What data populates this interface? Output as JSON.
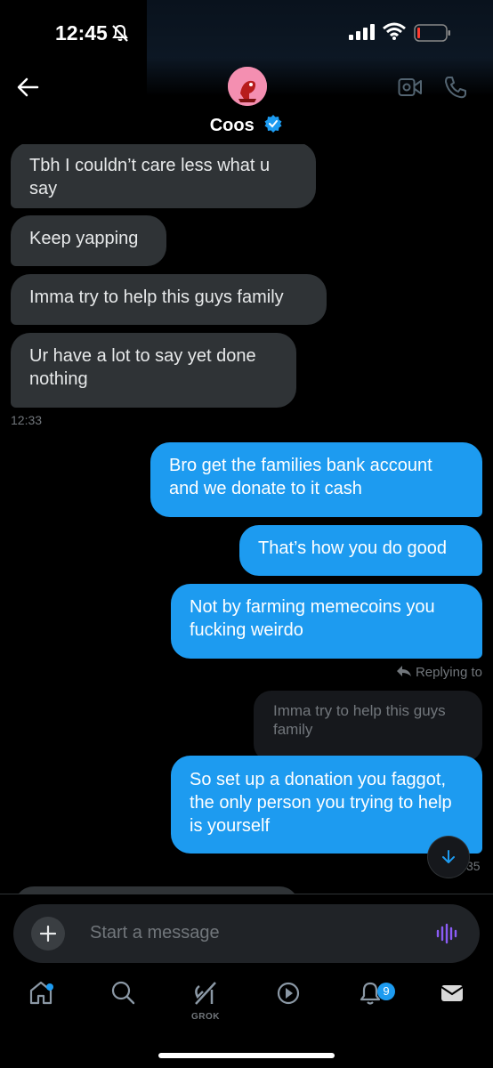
{
  "status_bar": {
    "time": "12:45"
  },
  "header": {
    "name": "Coos"
  },
  "messages": [
    {
      "type": "received",
      "text": "Tbh I couldn’t care less what u say"
    },
    {
      "type": "received",
      "text": "Keep yapping"
    },
    {
      "type": "received",
      "text": "Imma try to help this guys family"
    },
    {
      "type": "received",
      "text": "Ur have a lot to say yet done nothing"
    },
    {
      "type": "sent",
      "text": "Bro get the families bank account and we donate to it cash"
    },
    {
      "type": "sent",
      "text": "That’s how you do good"
    },
    {
      "type": "sent",
      "text": "Not by farming memecoins you fucking weirdo"
    },
    {
      "type": "sent",
      "text": "So set up a donation you faggot, the only person you trying to help is yourself"
    }
  ],
  "timestamps": {
    "received_group": "12:33",
    "sent_last": "35"
  },
  "reply": {
    "label": "Replying to",
    "quoted_text": "Imma try to help this guys family"
  },
  "composer": {
    "placeholder": "Start a message"
  },
  "tabbar": {
    "grok_label": "GROK",
    "notifications_count": "9"
  },
  "colors": {
    "accent": "#1d9bf0",
    "received_bubble": "#2f3336",
    "background": "#000000",
    "voice": "#8b5cf6"
  },
  "icons": [
    "back-arrow-icon",
    "verified-badge-icon",
    "video-call-icon",
    "phone-call-icon",
    "plus-icon",
    "voice-icon",
    "home-icon",
    "search-icon",
    "grok-icon",
    "video-icon",
    "bell-icon",
    "mail-icon",
    "chevron-down-icon"
  ]
}
